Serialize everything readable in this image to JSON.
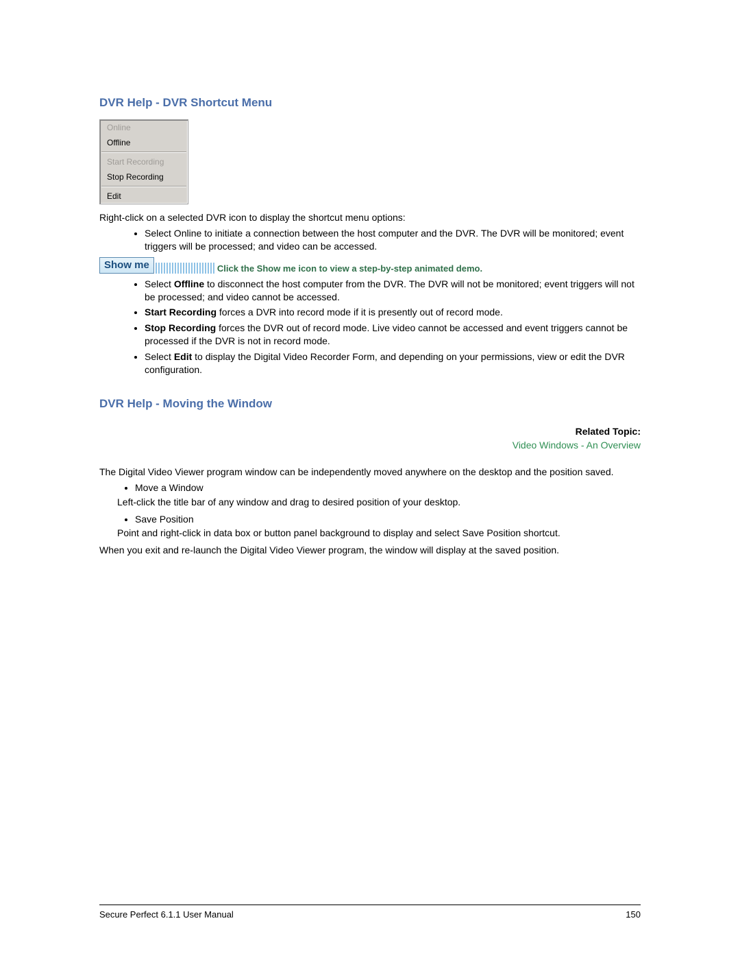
{
  "section1": {
    "title": "DVR Help - DVR Shortcut Menu",
    "menu": {
      "online": "Online",
      "offline": "Offline",
      "start_rec": "Start Recording",
      "stop_rec": "Stop Recording",
      "edit": "Edit"
    },
    "intro": "Right-click on a selected DVR icon to display the shortcut menu options:",
    "bullet_online": "Select Online to initiate a connection between the host computer and the DVR. The DVR will be monitored; event triggers will be processed; and video can be accessed.",
    "showme_label": "Show me",
    "showme_text": "Click the Show me icon to view a step-by-step animated demo.",
    "offline_pre": "Select ",
    "offline_bold": "Offline",
    "offline_post": " to disconnect the host computer from the DVR. The DVR will not be monitored; event triggers will not be processed; and video cannot be accessed.",
    "startrec_bold": "Start Recording",
    "startrec_post": " forces a DVR into record mode if it is presently out of record mode.",
    "stoprec_bold": "Stop Recording",
    "stoprec_post": " forces the DVR out of record mode. Live video cannot be accessed and event triggers cannot be processed if the DVR is not in record mode.",
    "edit_pre": "Select ",
    "edit_bold": "Edit",
    "edit_post": " to display the Digital Video Recorder Form, and depending on your permissions, view or edit the DVR configuration."
  },
  "section2": {
    "title": "DVR Help - Moving the Window",
    "related_label": "Related Topic:",
    "related_link": "Video Windows - An Overview",
    "intro": "The Digital Video Viewer program window can be independently moved anywhere on the desktop and the position saved.",
    "move_head": "Move a Window",
    "move_body": "Left-click the title bar of any window and drag to desired position of your desktop.",
    "save_head": "Save Position",
    "save_body": "Point and right-click in data box or button panel background to display and select Save Position shortcut.",
    "outro": "When you exit and re-launch the Digital Video Viewer program, the window will display at the saved position."
  },
  "footer": {
    "left": "Secure Perfect 6.1.1 User Manual",
    "right": "150"
  }
}
